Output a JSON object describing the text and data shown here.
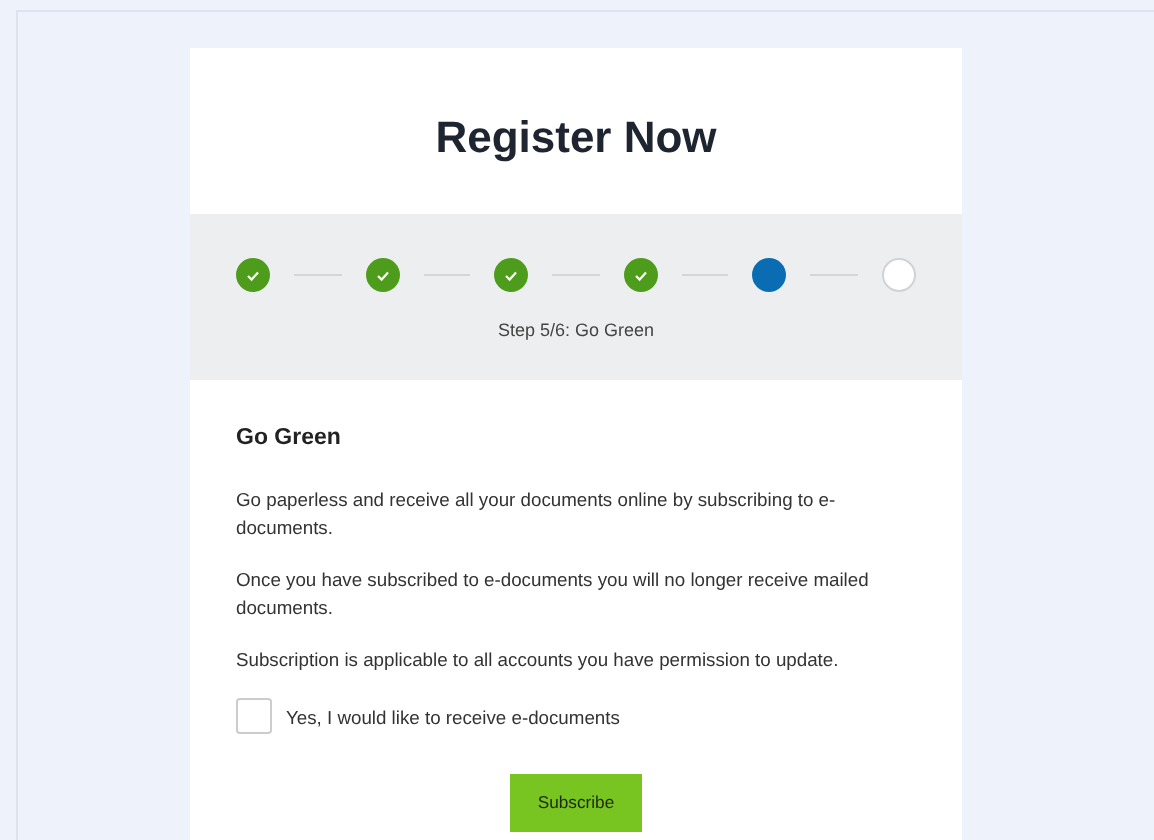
{
  "title": "Register Now",
  "steps": [
    {
      "kind": "done"
    },
    {
      "kind": "done"
    },
    {
      "kind": "done"
    },
    {
      "kind": "done"
    },
    {
      "kind": "current"
    },
    {
      "kind": "todo"
    }
  ],
  "step_label": "Step 5/6: Go Green",
  "section_title": "Go Green",
  "paragraphs": [
    "Go paperless and receive all your documents online by subscribing to e-documents.",
    "Once you have subscribed to e-documents you will no longer receive mailed documents.",
    "Subscription is applicable to all accounts you have permission to update."
  ],
  "consent": {
    "label": "Yes, I would like to receive e-documents",
    "checked": false
  },
  "submit_button": "Subscribe"
}
